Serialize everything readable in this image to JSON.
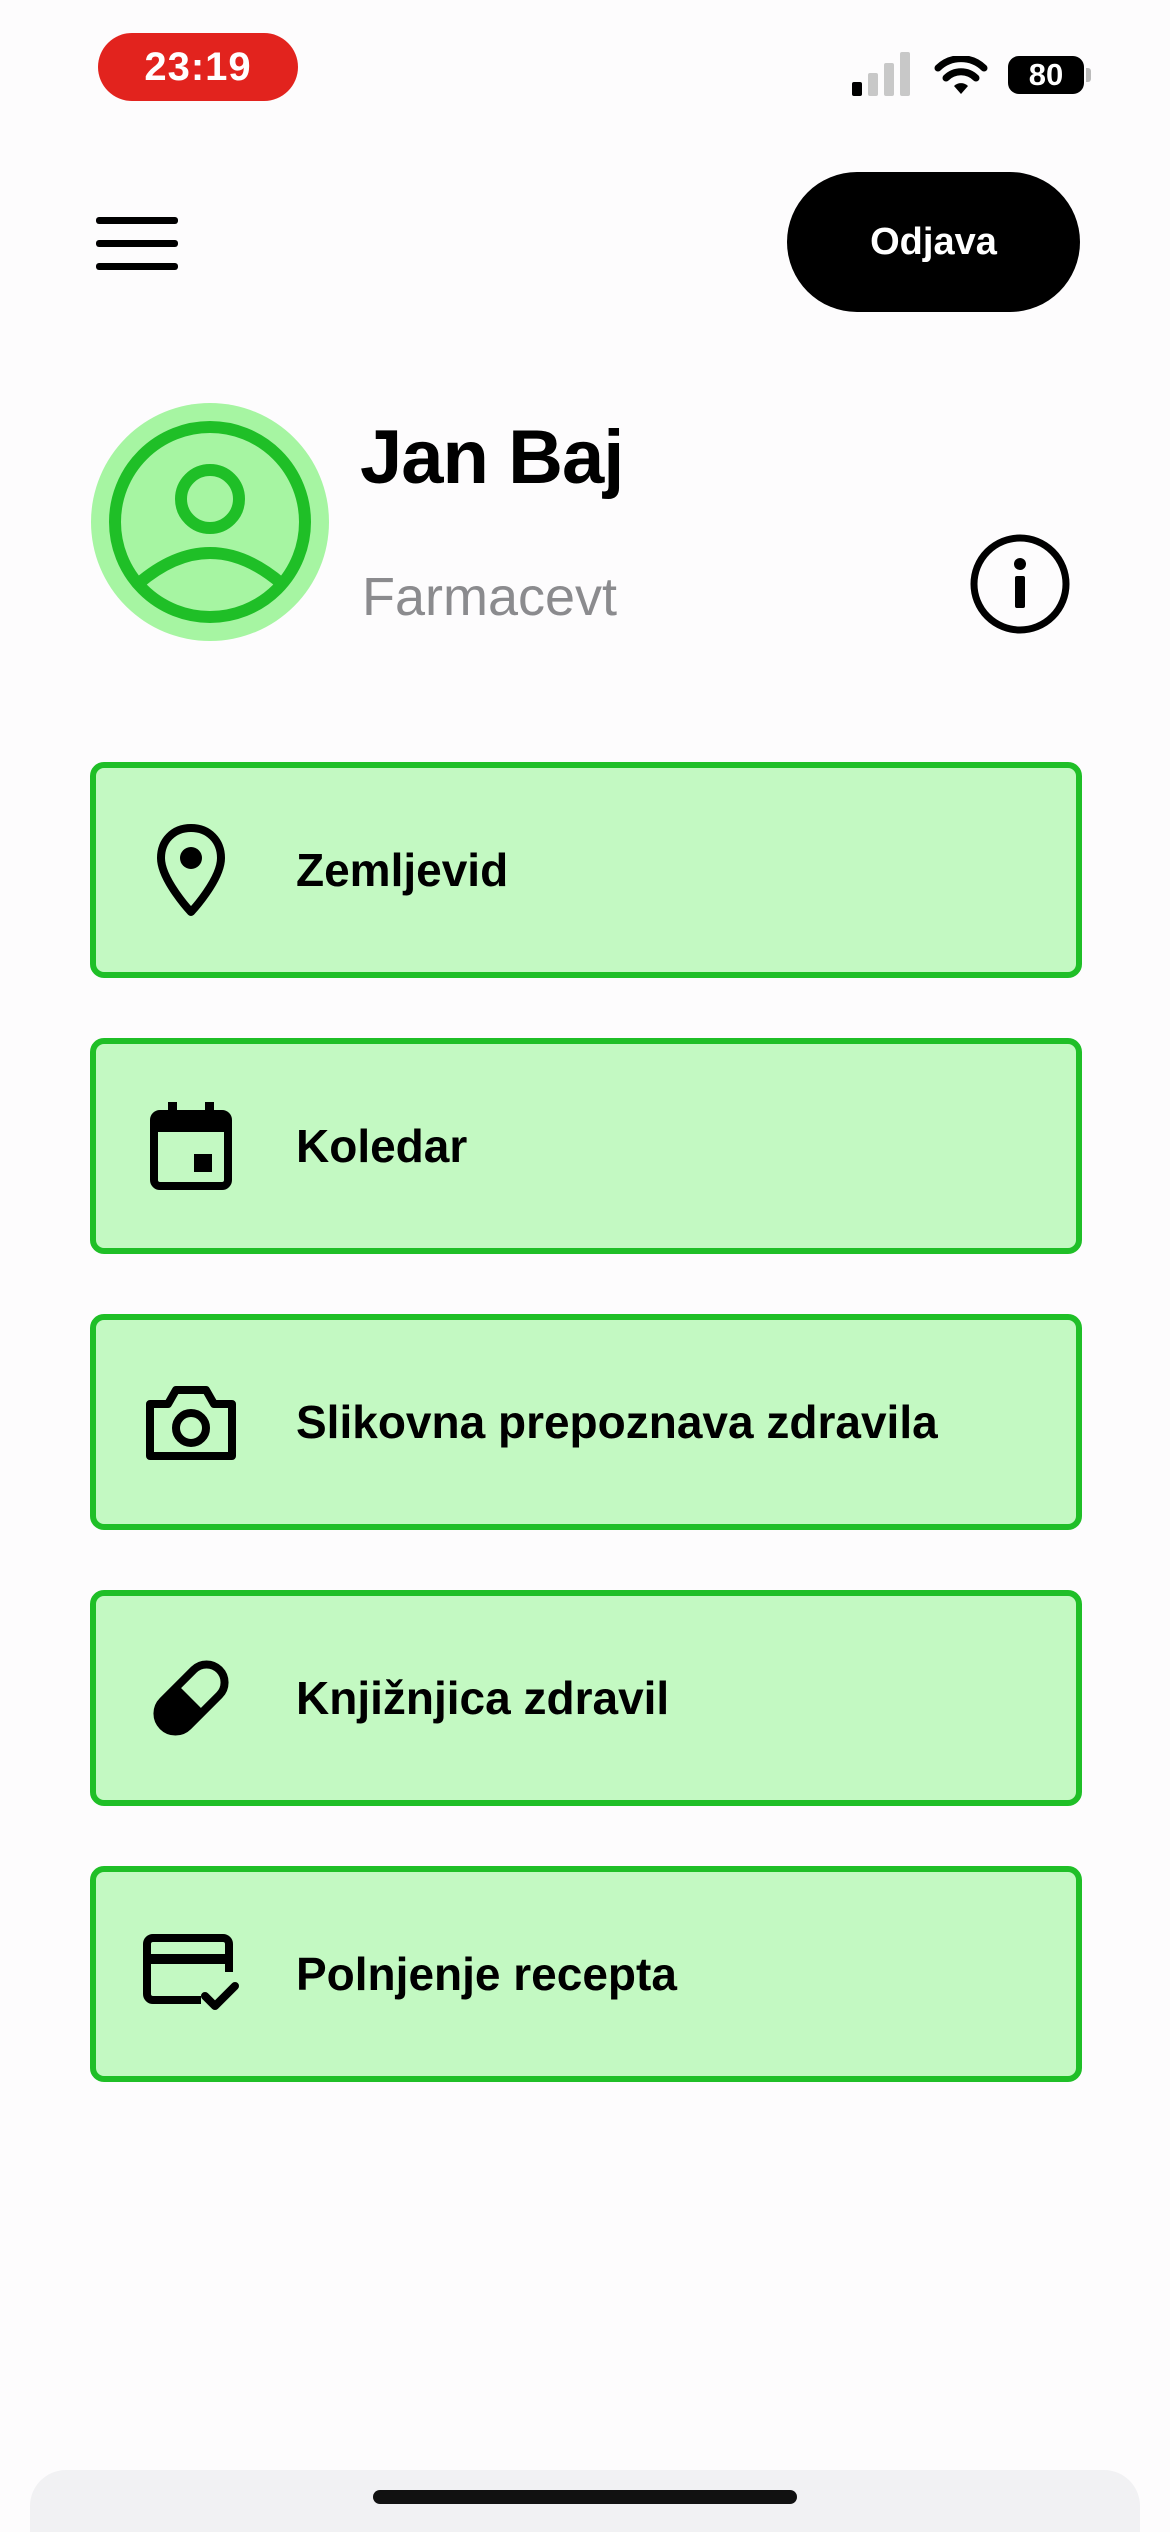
{
  "status_bar": {
    "time": "23:19",
    "battery": "80"
  },
  "header": {
    "menu_icon": "hamburger-menu-icon",
    "logout_label": "Odjava"
  },
  "profile": {
    "name": "Jan Baj",
    "role": "Farmacevt",
    "avatar_icon": "user-circle-icon",
    "info_icon": "info-icon"
  },
  "menu": {
    "items": [
      {
        "label": "Zemljevid",
        "icon": "location-pin-icon"
      },
      {
        "label": "Koledar",
        "icon": "calendar-icon"
      },
      {
        "label": "Slikovna prepoznava zdravila",
        "icon": "camera-icon"
      },
      {
        "label": "Knjižnjica zdravil",
        "icon": "pill-icon"
      },
      {
        "label": "Polnjenje recepta",
        "icon": "card-check-icon"
      }
    ]
  },
  "colors": {
    "accent_green": "#1fbf27",
    "card_background": "#c3f9c2",
    "avatar_halo": "#a6f5a2",
    "time_pill": "#e2231e"
  }
}
